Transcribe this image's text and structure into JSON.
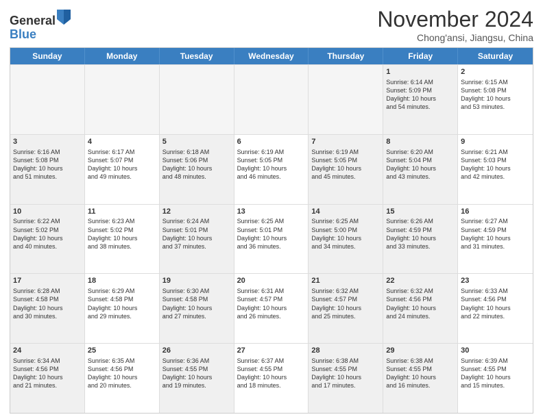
{
  "logo": {
    "general": "General",
    "blue": "Blue"
  },
  "title": "November 2024",
  "location": "Chong'ansi, Jiangsu, China",
  "header_days": [
    "Sunday",
    "Monday",
    "Tuesday",
    "Wednesday",
    "Thursday",
    "Friday",
    "Saturday"
  ],
  "weeks": [
    [
      {
        "day": "",
        "info": "",
        "empty": true
      },
      {
        "day": "",
        "info": "",
        "empty": true
      },
      {
        "day": "",
        "info": "",
        "empty": true
      },
      {
        "day": "",
        "info": "",
        "empty": true
      },
      {
        "day": "",
        "info": "",
        "empty": true
      },
      {
        "day": "1",
        "info": "Sunrise: 6:14 AM\nSunset: 5:09 PM\nDaylight: 10 hours\nand 54 minutes.",
        "shaded": true
      },
      {
        "day": "2",
        "info": "Sunrise: 6:15 AM\nSunset: 5:08 PM\nDaylight: 10 hours\nand 53 minutes."
      }
    ],
    [
      {
        "day": "3",
        "info": "Sunrise: 6:16 AM\nSunset: 5:08 PM\nDaylight: 10 hours\nand 51 minutes.",
        "shaded": true
      },
      {
        "day": "4",
        "info": "Sunrise: 6:17 AM\nSunset: 5:07 PM\nDaylight: 10 hours\nand 49 minutes."
      },
      {
        "day": "5",
        "info": "Sunrise: 6:18 AM\nSunset: 5:06 PM\nDaylight: 10 hours\nand 48 minutes.",
        "shaded": true
      },
      {
        "day": "6",
        "info": "Sunrise: 6:19 AM\nSunset: 5:05 PM\nDaylight: 10 hours\nand 46 minutes."
      },
      {
        "day": "7",
        "info": "Sunrise: 6:19 AM\nSunset: 5:05 PM\nDaylight: 10 hours\nand 45 minutes.",
        "shaded": true
      },
      {
        "day": "8",
        "info": "Sunrise: 6:20 AM\nSunset: 5:04 PM\nDaylight: 10 hours\nand 43 minutes.",
        "shaded": true
      },
      {
        "day": "9",
        "info": "Sunrise: 6:21 AM\nSunset: 5:03 PM\nDaylight: 10 hours\nand 42 minutes."
      }
    ],
    [
      {
        "day": "10",
        "info": "Sunrise: 6:22 AM\nSunset: 5:02 PM\nDaylight: 10 hours\nand 40 minutes.",
        "shaded": true
      },
      {
        "day": "11",
        "info": "Sunrise: 6:23 AM\nSunset: 5:02 PM\nDaylight: 10 hours\nand 38 minutes."
      },
      {
        "day": "12",
        "info": "Sunrise: 6:24 AM\nSunset: 5:01 PM\nDaylight: 10 hours\nand 37 minutes.",
        "shaded": true
      },
      {
        "day": "13",
        "info": "Sunrise: 6:25 AM\nSunset: 5:01 PM\nDaylight: 10 hours\nand 36 minutes."
      },
      {
        "day": "14",
        "info": "Sunrise: 6:25 AM\nSunset: 5:00 PM\nDaylight: 10 hours\nand 34 minutes.",
        "shaded": true
      },
      {
        "day": "15",
        "info": "Sunrise: 6:26 AM\nSunset: 4:59 PM\nDaylight: 10 hours\nand 33 minutes.",
        "shaded": true
      },
      {
        "day": "16",
        "info": "Sunrise: 6:27 AM\nSunset: 4:59 PM\nDaylight: 10 hours\nand 31 minutes."
      }
    ],
    [
      {
        "day": "17",
        "info": "Sunrise: 6:28 AM\nSunset: 4:58 PM\nDaylight: 10 hours\nand 30 minutes.",
        "shaded": true
      },
      {
        "day": "18",
        "info": "Sunrise: 6:29 AM\nSunset: 4:58 PM\nDaylight: 10 hours\nand 29 minutes."
      },
      {
        "day": "19",
        "info": "Sunrise: 6:30 AM\nSunset: 4:58 PM\nDaylight: 10 hours\nand 27 minutes.",
        "shaded": true
      },
      {
        "day": "20",
        "info": "Sunrise: 6:31 AM\nSunset: 4:57 PM\nDaylight: 10 hours\nand 26 minutes."
      },
      {
        "day": "21",
        "info": "Sunrise: 6:32 AM\nSunset: 4:57 PM\nDaylight: 10 hours\nand 25 minutes.",
        "shaded": true
      },
      {
        "day": "22",
        "info": "Sunrise: 6:32 AM\nSunset: 4:56 PM\nDaylight: 10 hours\nand 24 minutes.",
        "shaded": true
      },
      {
        "day": "23",
        "info": "Sunrise: 6:33 AM\nSunset: 4:56 PM\nDaylight: 10 hours\nand 22 minutes."
      }
    ],
    [
      {
        "day": "24",
        "info": "Sunrise: 6:34 AM\nSunset: 4:56 PM\nDaylight: 10 hours\nand 21 minutes.",
        "shaded": true
      },
      {
        "day": "25",
        "info": "Sunrise: 6:35 AM\nSunset: 4:56 PM\nDaylight: 10 hours\nand 20 minutes."
      },
      {
        "day": "26",
        "info": "Sunrise: 6:36 AM\nSunset: 4:55 PM\nDaylight: 10 hours\nand 19 minutes.",
        "shaded": true
      },
      {
        "day": "27",
        "info": "Sunrise: 6:37 AM\nSunset: 4:55 PM\nDaylight: 10 hours\nand 18 minutes."
      },
      {
        "day": "28",
        "info": "Sunrise: 6:38 AM\nSunset: 4:55 PM\nDaylight: 10 hours\nand 17 minutes.",
        "shaded": true
      },
      {
        "day": "29",
        "info": "Sunrise: 6:38 AM\nSunset: 4:55 PM\nDaylight: 10 hours\nand 16 minutes.",
        "shaded": true
      },
      {
        "day": "30",
        "info": "Sunrise: 6:39 AM\nSunset: 4:55 PM\nDaylight: 10 hours\nand 15 minutes."
      }
    ]
  ]
}
